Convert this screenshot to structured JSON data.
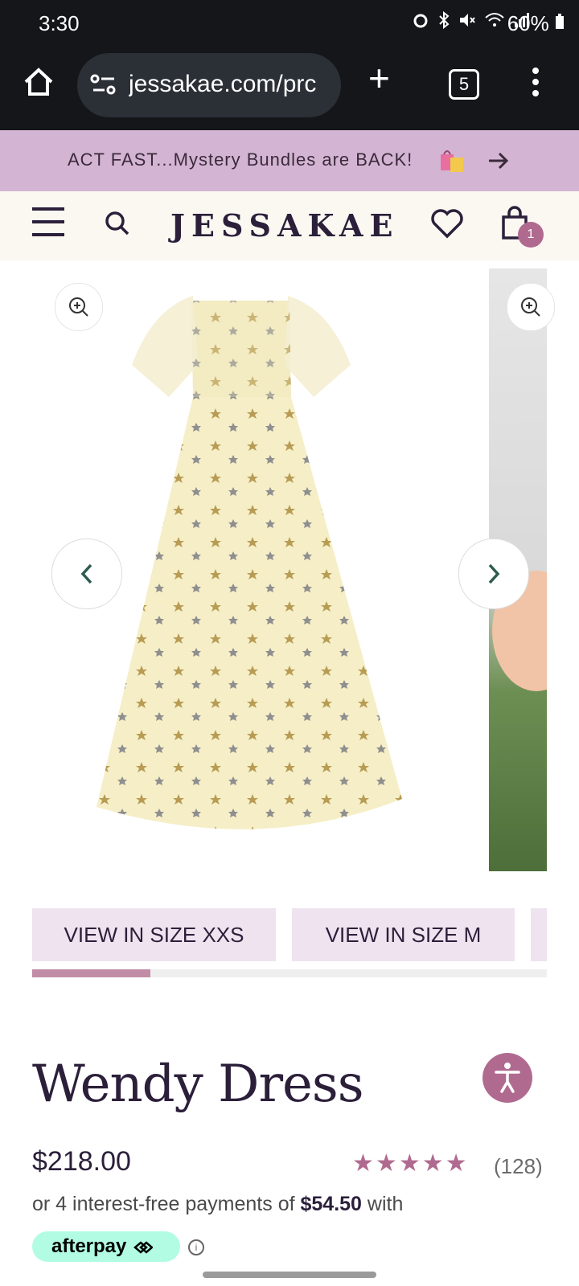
{
  "status_bar": {
    "time": "3:30",
    "battery": "60%"
  },
  "browser": {
    "url": "jessakae.com/prc",
    "tab_count": "5"
  },
  "promo": {
    "text": "ACT FAST...Mystery Bundles are BACK!"
  },
  "header": {
    "logo": "JESSAKAE",
    "cart_count": "1"
  },
  "gallery": {
    "size_buttons": [
      "VIEW IN SIZE XXS",
      "VIEW IN SIZE M"
    ],
    "progress": 0.23
  },
  "product": {
    "title": "Wendy Dress",
    "price": "$218.00",
    "rating_stars": 5,
    "review_count": "(128)",
    "installment_prefix": "or 4 interest-free payments of",
    "installment_amount": "$54.50",
    "installment_suffix": "with",
    "afterpay_label": "afterpay"
  },
  "colors": {
    "promo_bg": "#d3b5d3",
    "brand_text": "#2b1f3a",
    "accent": "#b06a8f",
    "afterpay_bg": "#b2fce4"
  }
}
